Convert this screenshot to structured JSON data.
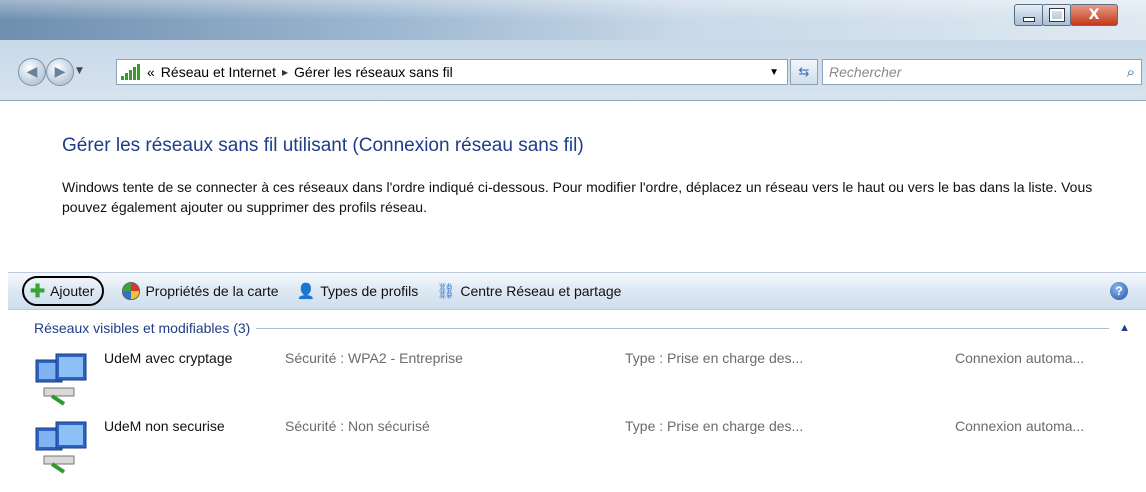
{
  "window": {
    "close_glyph": "X"
  },
  "address": {
    "prefix": "«",
    "crumb1": "Réseau et Internet",
    "separator": "▸",
    "crumb2": "Gérer les réseaux sans fil"
  },
  "search": {
    "placeholder": "Rechercher"
  },
  "header": {
    "title": "Gérer les réseaux sans fil utilisant (Connexion réseau sans fil)",
    "description": "Windows tente de se connecter à ces réseaux dans l'ordre indiqué ci-dessous. Pour modifier l'ordre, déplacez un réseau vers le haut ou vers le bas dans la liste. Vous pouvez également ajouter ou supprimer des profils réseau."
  },
  "toolbar": {
    "add_label": "Ajouter",
    "adapter_props_label": "Propriétés de la carte",
    "profile_types_label": "Types de profils",
    "network_center_label": "Centre Réseau et partage"
  },
  "group": {
    "title": "Réseaux visibles et modifiables (3)"
  },
  "networks": [
    {
      "name": "UdeM avec cryptage",
      "security": "Sécurité : WPA2 - Entreprise",
      "type": "Type : Prise en charge des...",
      "connection": "Connexion automa..."
    },
    {
      "name": "UdeM non securise",
      "security": "Sécurité : Non sécurisé",
      "type": "Type : Prise en charge des...",
      "connection": "Connexion automa..."
    }
  ],
  "icons": {
    "back": "back-arrow-icon",
    "forward": "forward-arrow-icon",
    "network": "signal-bars-icon",
    "refresh": "refresh-icon",
    "search": "search-icon",
    "add": "plus-icon",
    "adapter": "shield-icon",
    "profiles": "user-icon",
    "center": "network-center-icon",
    "help": "help-icon",
    "wireless_network": "wireless-network-icon"
  }
}
